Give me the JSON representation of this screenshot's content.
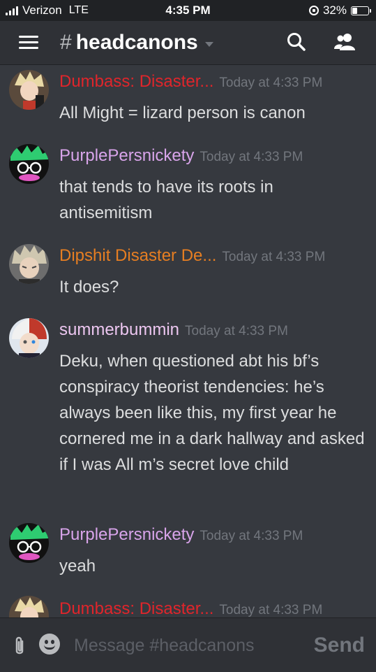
{
  "status_bar": {
    "carrier": "Verizon",
    "network": "LTE",
    "time": "4:35 PM",
    "battery": "32%",
    "battery_level": 0.32
  },
  "header": {
    "hash": "#",
    "channel": "headcanons",
    "icons": [
      "menu-icon",
      "search-icon",
      "members-icon"
    ]
  },
  "messages": [
    {
      "username": "Dumbass: Disaster...",
      "color": "#e0252b",
      "timestamp": "Today at 4:33 PM",
      "text": "All Might = lizard person is canon"
    },
    {
      "username": "PurplePersnickety",
      "color": "#d8a4ea",
      "timestamp": "Today at 4:33 PM",
      "text": "that tends to have its roots in antisemitism"
    },
    {
      "username": "Dipshit Disaster De...",
      "color": "#e67e22",
      "timestamp": "Today at 4:33 PM",
      "text": "It does?"
    },
    {
      "username": "summerbummin",
      "color": "#ecc6f0",
      "timestamp": "Today at 4:33 PM",
      "text": "Deku, when questioned abt his bf’s conspiracy theorist tendencies: he’s always been like this, my first year he cornered me in a dark hallway and asked if I was All m’s secret love child"
    },
    {
      "username": "PurplePersnickety",
      "color": "#d8a4ea",
      "timestamp": "Today at 4:33 PM",
      "text": "yeah"
    },
    {
      "username": "Dumbass: Disaster...",
      "color": "#e0252b",
      "timestamp": "Today at 4:33 PM",
      "text": ""
    }
  ],
  "composer": {
    "placeholder": "Message #headcanons",
    "send_label": "Send"
  }
}
